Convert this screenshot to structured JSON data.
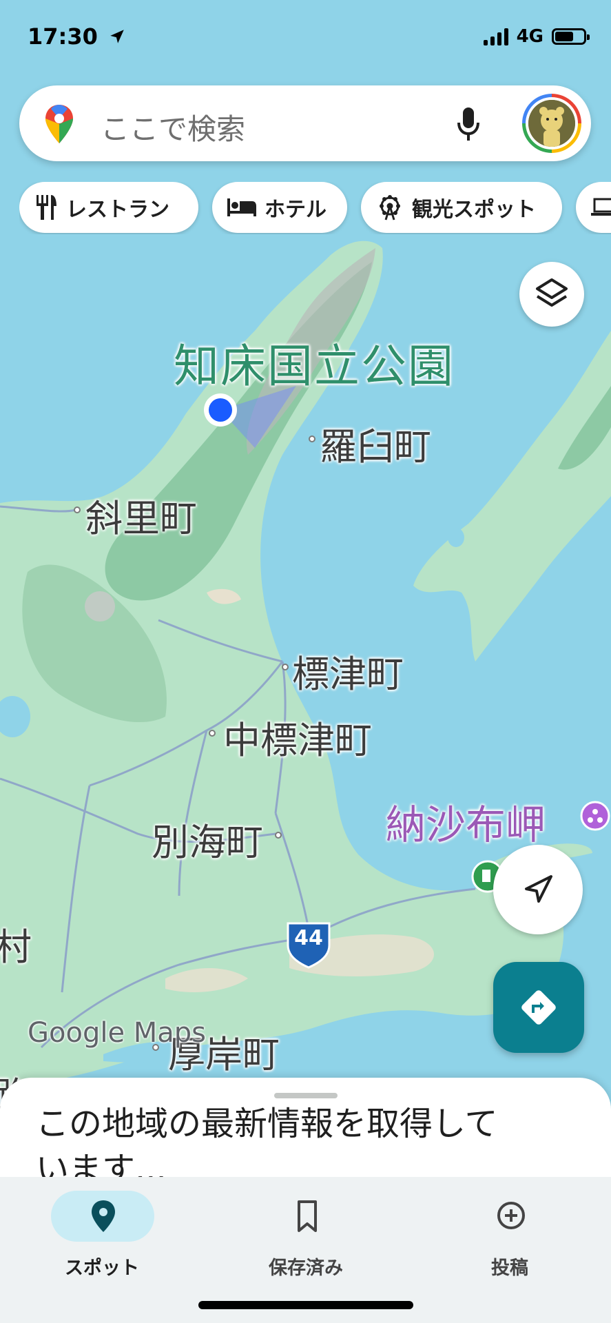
{
  "status_bar": {
    "time": "17:30",
    "network": "4G"
  },
  "search": {
    "placeholder": "ここで検索"
  },
  "chips": [
    {
      "label": "レストラン",
      "icon": "restaurant-icon"
    },
    {
      "label": "ホテル",
      "icon": "hotel-bed-icon"
    },
    {
      "label": "観光スポット",
      "icon": "ferris-wheel-icon"
    }
  ],
  "map": {
    "park_label": "知床国立公園",
    "towns": [
      "羅臼町",
      "斜里町",
      "標津町",
      "中標津町",
      "別海町",
      "厚岸町"
    ],
    "partial_labels": [
      "村",
      "路"
    ],
    "poi_label": "納沙布岬",
    "route_number": "44",
    "watermark": "Google Maps"
  },
  "buttons": {
    "layers_icon": "layers-icon",
    "locate_icon": "navigation-arrow-icon",
    "directions_icon": "directions-icon"
  },
  "sheet": {
    "message": "この地域の最新情報を取得しています..."
  },
  "bottom_nav": [
    {
      "label": "スポット",
      "icon": "place-pin-icon",
      "active": true
    },
    {
      "label": "保存済み",
      "icon": "bookmark-icon",
      "active": false
    },
    {
      "label": "投稿",
      "icon": "add-circle-icon",
      "active": false
    }
  ],
  "colors": {
    "water": "#8fd3e8",
    "land": "#b7e3c7",
    "accent_teal": "#0b7f8f",
    "park_label": "#2f8f6b",
    "poi_purple": "#9b59b6",
    "location_dot": "#1a5cff"
  }
}
